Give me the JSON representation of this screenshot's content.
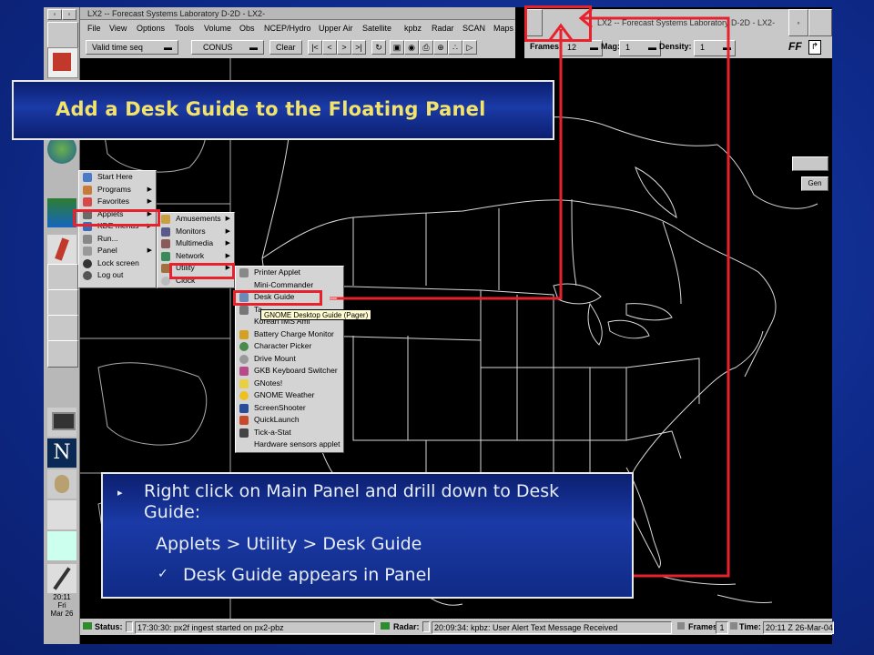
{
  "slide": {
    "title": "Add a Desk Guide to the Floating Panel",
    "bullet": "Right click on Main Panel and drill down to Desk Guide:",
    "path_line": "Applets > Utility > Desk Guide",
    "check_line": "Desk Guide appears in Panel"
  },
  "window": {
    "title": "LX2 -- Forecast Systems Laboratory D-2D - LX2-",
    "second_title": "LX2 -- Forecast Systems Laboratory D-2D - LX2-",
    "menu": [
      "File",
      "View",
      "Options",
      "Tools",
      "Volume",
      "Obs",
      "NCEP/Hydro",
      "Upper Air",
      "Satellite",
      "kpbz",
      "Radar",
      "SCAN",
      "Maps"
    ],
    "toolbar": {
      "time_select": "Valid time seq",
      "area_select": "CONUS",
      "clear_button": "Clear"
    },
    "frames_bar": {
      "frames_label": "Frames:",
      "frames_value": "12",
      "mag_label": "Mag:",
      "mag_value": "1",
      "density_label": "Density:",
      "density_value": "1",
      "ff_label": "FF"
    },
    "side_button": "Gen"
  },
  "gnome_panel": {
    "clock": [
      "20:11",
      "Fri",
      "Mar 26"
    ]
  },
  "main_menu": [
    {
      "label": "Start Here",
      "arrow": false
    },
    {
      "label": "Programs",
      "arrow": true
    },
    {
      "label": "Favorites",
      "arrow": true
    },
    {
      "label": "Applets",
      "arrow": true
    },
    {
      "label": "KDE menus",
      "arrow": true
    },
    {
      "label": "Run...",
      "arrow": false
    },
    {
      "label": "Panel",
      "arrow": true
    },
    {
      "label": "Lock screen",
      "arrow": false
    },
    {
      "label": "Log out",
      "arrow": false
    }
  ],
  "applets_menu": [
    {
      "label": "Amusements",
      "arrow": true
    },
    {
      "label": "Monitors",
      "arrow": true
    },
    {
      "label": "Multimedia",
      "arrow": true
    },
    {
      "label": "Network",
      "arrow": true
    },
    {
      "label": "Utility",
      "arrow": true
    },
    {
      "label": "Clock",
      "arrow": false
    }
  ],
  "utility_menu": [
    "Printer Applet",
    "Mini-Commander",
    "Desk Guide",
    "Ta",
    "Korean IMS Aml",
    "Battery Charge Monitor",
    "Character Picker",
    "Drive Mount",
    "GKB Keyboard Switcher",
    "GNotes!",
    "GNOME Weather",
    "ScreenShooter",
    "QuickLaunch",
    "Tick-a-Stat",
    "Hardware sensors applet"
  ],
  "tooltip": "GNOME Desktop Guide (Pager)",
  "status_bar": {
    "status_label": "Status:",
    "status_text": "17:30:30: px2f ingest started on px2-pbz",
    "radar_label": "Radar:",
    "radar_text": "20:09:34: kpbz: User Alert Text Message Received",
    "frames_label": "Frames:",
    "frames_value": "1",
    "time_label": "Time:",
    "time_value": "20:11 Z 26-Mar-04"
  },
  "colors": {
    "title_text": "#f2e36a",
    "highlight": "#e8222c",
    "map_lines": "#d8d8d8"
  }
}
